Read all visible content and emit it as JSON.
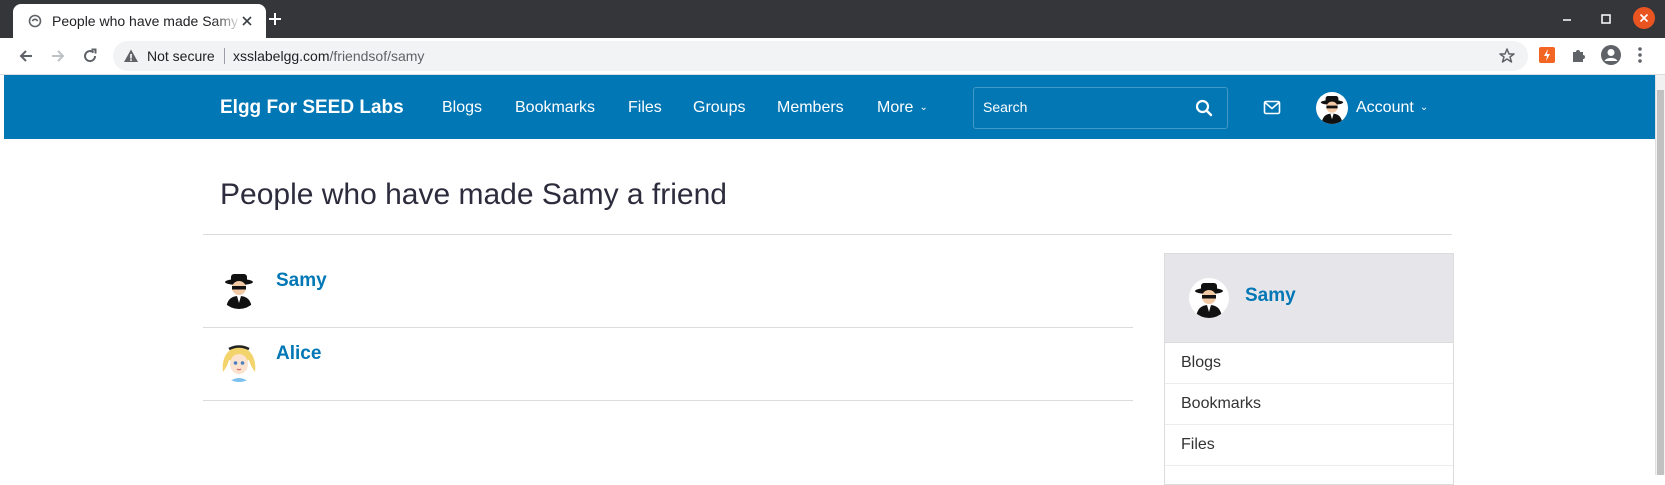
{
  "browser": {
    "tab_title": "People who have made Samy a friend",
    "omnibox": {
      "security_label": "Not secure",
      "host": "xsslabelgg.com",
      "path": "/friendsof/samy"
    }
  },
  "topbar": {
    "brand": "Elgg For SEED Labs",
    "menu": [
      "Blogs",
      "Bookmarks",
      "Files",
      "Groups",
      "Members",
      "More"
    ],
    "search_placeholder": "Search",
    "account_label": "Account"
  },
  "page": {
    "title": "People who have made Samy a friend",
    "friends": [
      {
        "name": "Samy",
        "avatar": "spy-avatar"
      },
      {
        "name": "Alice",
        "avatar": "alice-avatar"
      }
    ]
  },
  "sidebar": {
    "owner_name": "Samy",
    "links": [
      "Blogs",
      "Bookmarks",
      "Files"
    ]
  },
  "colors": {
    "brand_blue": "#0277b5",
    "chrome_dark": "#35363a",
    "close_orange": "#e95420"
  }
}
